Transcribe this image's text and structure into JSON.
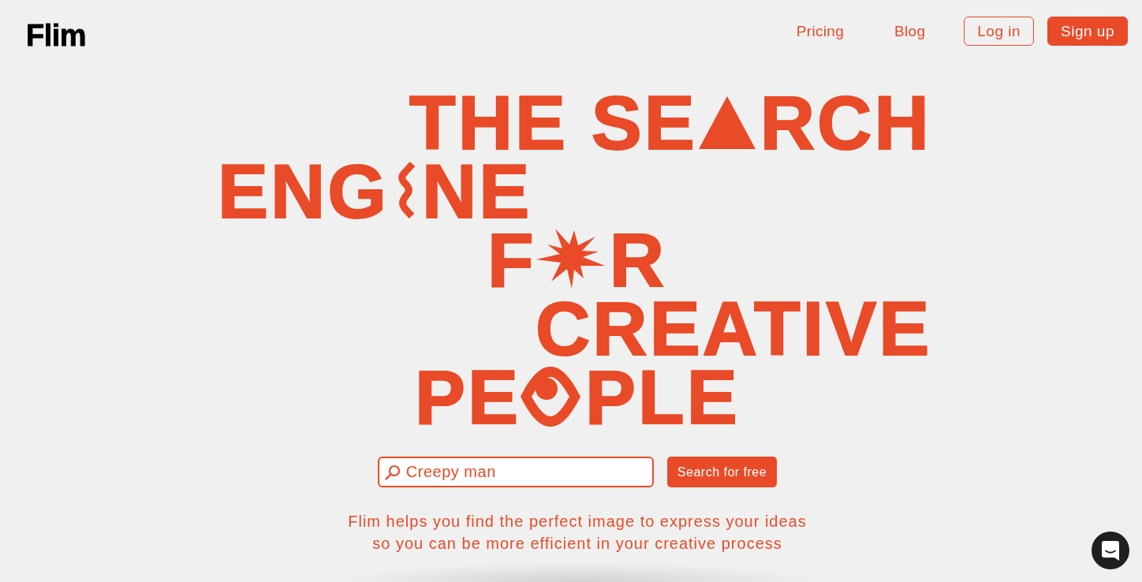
{
  "header": {
    "logo": "Flim",
    "nav": [
      {
        "label": "Pricing",
        "kind": "link"
      },
      {
        "label": "Blog",
        "kind": "link"
      },
      {
        "label": "Log in",
        "kind": "outline"
      },
      {
        "label": "Sign up",
        "kind": "filled"
      }
    ]
  },
  "headline": {
    "lines": [
      {
        "parts": [
          {
            "kind": "text",
            "text": "THE SE"
          },
          {
            "kind": "triangle"
          },
          {
            "kind": "text",
            "text": "RCH"
          }
        ]
      },
      {
        "parts": [
          {
            "kind": "text",
            "text": "ENG"
          },
          {
            "kind": "squiggle"
          },
          {
            "kind": "text",
            "text": "NE"
          }
        ]
      },
      {
        "parts": [
          {
            "kind": "text",
            "text": "F"
          },
          {
            "kind": "star"
          },
          {
            "kind": "text",
            "text": "R"
          }
        ]
      },
      {
        "parts": [
          {
            "kind": "text",
            "text": "CREATIVE"
          }
        ]
      },
      {
        "parts": [
          {
            "kind": "text",
            "text": "PE"
          },
          {
            "kind": "eye"
          },
          {
            "kind": "text",
            "text": "PLE"
          }
        ]
      }
    ]
  },
  "search": {
    "value": "Creepy man",
    "button": "Search for free"
  },
  "tagline": "Flim helps you find the perfect image to express your ideas so you can be more efficient in your creative process"
}
